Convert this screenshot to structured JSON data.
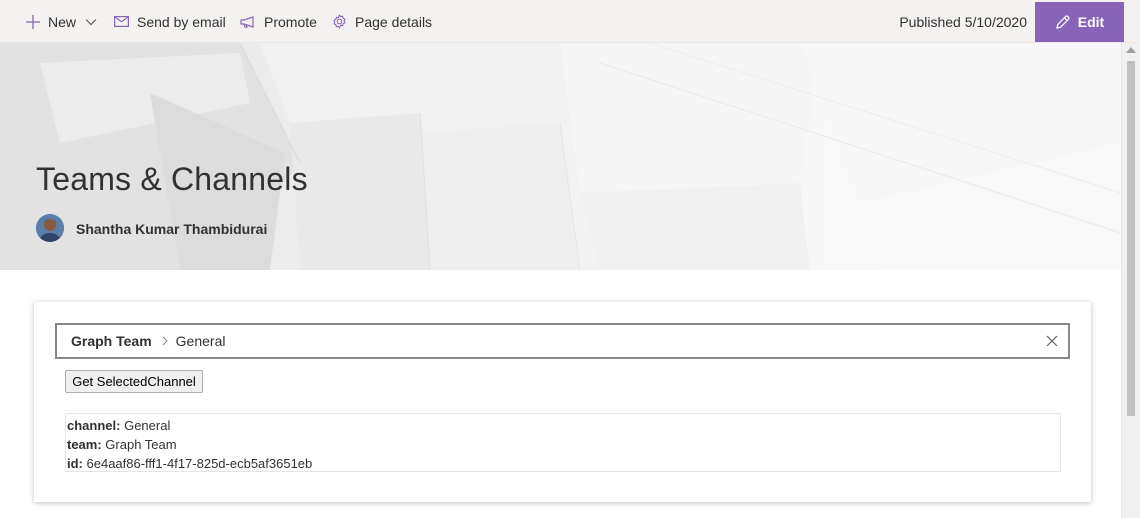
{
  "commandbar": {
    "new_label": "New",
    "send_email_label": "Send by email",
    "promote_label": "Promote",
    "page_details_label": "Page details",
    "published_text": "Published 5/10/2020",
    "edit_label": "Edit"
  },
  "header": {
    "title": "Teams & Channels",
    "author": "Shantha Kumar Thambidurai"
  },
  "picker": {
    "team": "Graph Team",
    "channel": "General"
  },
  "button": {
    "get_label": "Get SelectedChannel"
  },
  "result": {
    "channel_key": "channel:",
    "channel_value": " General",
    "team_key": "team:",
    "team_value": " Graph Team",
    "id_key": "id:",
    "id_value": " 6e4aaf86-fff1-4f17-825d-ecb5af3651eb"
  },
  "colors": {
    "accent": "#8764b8",
    "commandbar_bg": "#f3f2f1",
    "text": "#323130"
  }
}
